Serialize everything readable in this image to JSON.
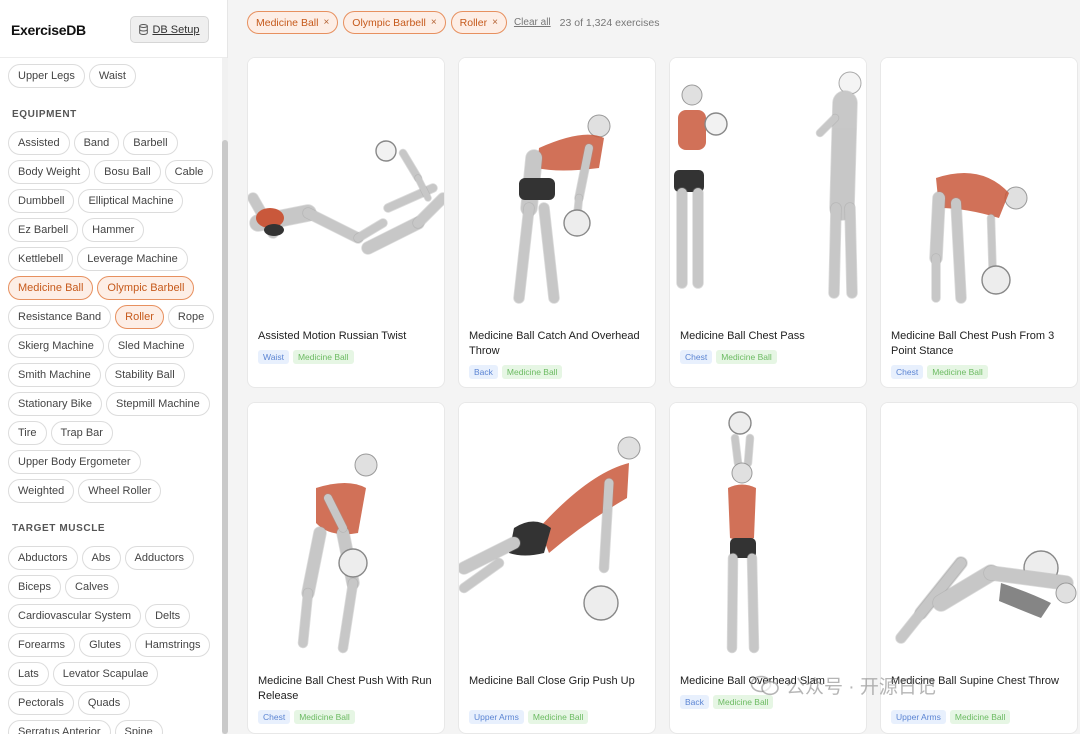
{
  "app": {
    "logo": "ExerciseDB",
    "db_setup_label": "DB Setup"
  },
  "sidebar": {
    "top_partial_row": [
      "Upper Legs",
      "Waist"
    ],
    "equipment_title": "EQUIPMENT",
    "equipment": [
      [
        "Assisted",
        "Band",
        "Barbell"
      ],
      [
        "Body Weight",
        "Bosu Ball",
        "Cable"
      ],
      [
        "Dumbbell",
        "Elliptical Machine"
      ],
      [
        "Ez Barbell",
        "Hammer"
      ],
      [
        "Kettlebell",
        "Leverage Machine"
      ],
      [
        "Medicine Ball",
        "Olympic Barbell"
      ],
      [
        "Resistance Band",
        "Roller",
        "Rope"
      ],
      [
        "Skierg Machine",
        "Sled Machine"
      ],
      [
        "Smith Machine",
        "Stability Ball"
      ],
      [
        "Stationary Bike",
        "Stepmill Machine"
      ],
      [
        "Tire",
        "Trap Bar"
      ],
      [
        "Upper Body Ergometer"
      ],
      [
        "Weighted",
        "Wheel Roller"
      ]
    ],
    "selected_equipment": [
      "Medicine Ball",
      "Olympic Barbell",
      "Roller"
    ],
    "target_title": "TARGET MUSCLE",
    "targets": [
      [
        "Abductors",
        "Abs",
        "Adductors"
      ],
      [
        "Biceps",
        "Calves"
      ],
      [
        "Cardiovascular System",
        "Delts"
      ],
      [
        "Forearms",
        "Glutes",
        "Hamstrings"
      ],
      [
        "Lats",
        "Levator Scapulae"
      ],
      [
        "Pectorals",
        "Quads"
      ],
      [
        "Serratus Anterior",
        "Spine"
      ]
    ]
  },
  "filters": {
    "active": [
      "Medicine Ball",
      "Olympic Barbell",
      "Roller"
    ],
    "remove_glyph": "×",
    "clear_label": "Clear all",
    "count_text": "23 of 1,324 exercises"
  },
  "cards": [
    {
      "title": "Assisted Motion Russian Twist",
      "tags": [
        {
          "text": "Waist",
          "kind": "b"
        },
        {
          "text": "Medicine Ball",
          "kind": "g"
        }
      ]
    },
    {
      "title": "Medicine Ball Catch And Overhead Throw",
      "tags": [
        {
          "text": "Back",
          "kind": "b"
        },
        {
          "text": "Medicine Ball",
          "kind": "g"
        }
      ]
    },
    {
      "title": "Medicine Ball Chest Pass",
      "tags": [
        {
          "text": "Chest",
          "kind": "b"
        },
        {
          "text": "Medicine Ball",
          "kind": "g"
        }
      ]
    },
    {
      "title": "Medicine Ball Chest Push From 3 Point Stance",
      "tags": [
        {
          "text": "Chest",
          "kind": "b"
        },
        {
          "text": "Medicine Ball",
          "kind": "g"
        }
      ]
    },
    {
      "title": "Medicine Ball Chest Push With Run Release",
      "tags": [
        {
          "text": "Chest",
          "kind": "b"
        },
        {
          "text": "Medicine Ball",
          "kind": "g"
        }
      ]
    },
    {
      "title": "Medicine Ball Close Grip Push Up",
      "tags": [
        {
          "text": "Upper Arms",
          "kind": "b"
        },
        {
          "text": "Medicine Ball",
          "kind": "g"
        }
      ]
    },
    {
      "title": "Medicine Ball Overhead Slam",
      "tags": [
        {
          "text": "Back",
          "kind": "b"
        },
        {
          "text": "Medicine Ball",
          "kind": "g"
        }
      ]
    },
    {
      "title": "Medicine Ball Supine Chest Throw",
      "tags": [
        {
          "text": "Upper Arms",
          "kind": "b"
        },
        {
          "text": "Medicine Ball",
          "kind": "g"
        }
      ]
    }
  ],
  "watermark": "公众号 · 开源日记",
  "colors": {
    "accent": "#e7905f",
    "accent_bg": "#fdeee6",
    "accent_text": "#c65a1c",
    "muscle_red": "#c9583b"
  }
}
